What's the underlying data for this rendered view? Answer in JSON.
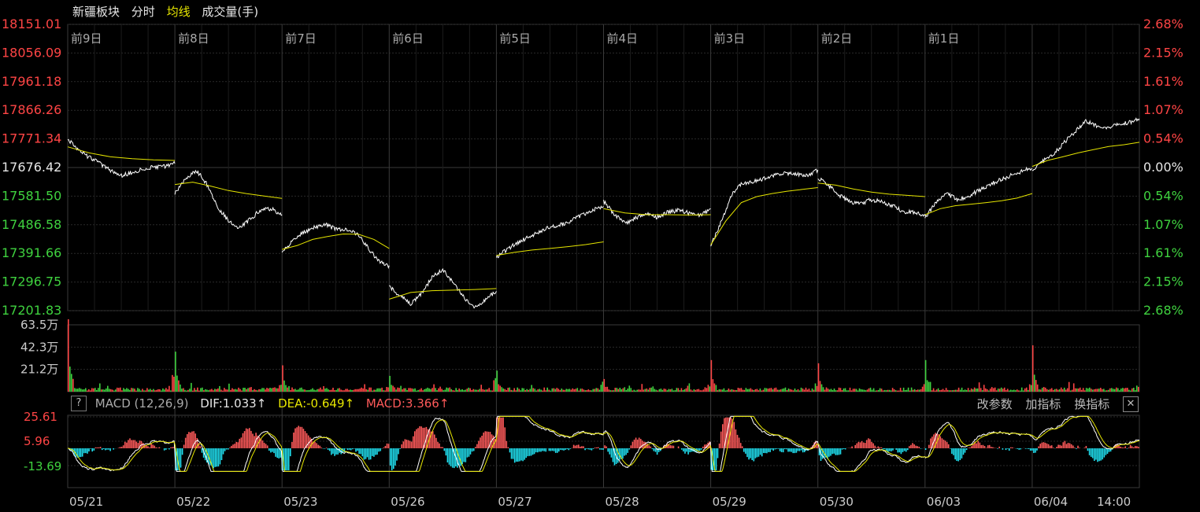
{
  "header": {
    "index_name": "新疆板块",
    "tab_intraday": "分时",
    "tab_avg": "均线",
    "tab_volume": "成交量(手)"
  },
  "colors": {
    "up": "#ff4545",
    "down": "#3fd23f",
    "price_line": "#ffffff",
    "avg_line": "#e6e600",
    "dea": "#e6e600",
    "macd_up": "#ff5a5a",
    "macd_down": "#20e0f0",
    "grid": "#2a2a2a"
  },
  "chart_data": {
    "type": "line",
    "day_labels": [
      "前9日",
      "前8日",
      "前7日",
      "前6日",
      "前5日",
      "前4日",
      "前3日",
      "前2日",
      "前1日",
      ""
    ],
    "x_dates": [
      "05/21",
      "05/22",
      "05/23",
      "05/26",
      "05/27",
      "05/28",
      "05/29",
      "05/30",
      "06/03",
      "06/04"
    ],
    "x_extra_label": "14:00",
    "y_left_ticks": [
      "18151.01",
      "18056.09",
      "17961.18",
      "17866.26",
      "17771.34",
      "17676.42",
      "17581.50",
      "17486.58",
      "17391.66",
      "17296.75",
      "17201.83"
    ],
    "y_right_ticks": [
      "2.68%",
      "2.15%",
      "1.61%",
      "1.07%",
      "0.54%",
      "0.00%",
      "0.54%",
      "1.07%",
      "1.61%",
      "2.15%",
      "2.68%"
    ],
    "ylim": [
      17201.83,
      18151.01
    ],
    "prev_close": 17676.42,
    "days": [
      {
        "price": [
          17770,
          17735,
          17710,
          17690,
          17665,
          17650,
          17660,
          17672,
          17678,
          17680,
          17690
        ],
        "avg": [
          17745,
          17725,
          17712,
          17706,
          17702,
          17700
        ]
      },
      {
        "price": [
          17592,
          17640,
          17668,
          17620,
          17545,
          17500,
          17475,
          17505,
          17535,
          17540,
          17520
        ],
        "avg": [
          17620,
          17628,
          17615,
          17600,
          17590,
          17582,
          17574
        ]
      },
      {
        "price": [
          17398,
          17432,
          17462,
          17478,
          17488,
          17472,
          17470,
          17458,
          17412,
          17365,
          17348
        ],
        "avg": [
          17405,
          17418,
          17438,
          17448,
          17456,
          17455,
          17438,
          17408
        ]
      },
      {
        "price": [
          17282,
          17252,
          17222,
          17258,
          17312,
          17338,
          17292,
          17244,
          17215,
          17238,
          17266
        ],
        "avg": [
          17240,
          17262,
          17268,
          17270,
          17272,
          17275
        ]
      },
      {
        "price": [
          17380,
          17405,
          17428,
          17445,
          17465,
          17478,
          17486,
          17500,
          17520,
          17535,
          17548
        ],
        "avg": [
          17385,
          17395,
          17403,
          17408,
          17414,
          17421,
          17430
        ]
      },
      {
        "price": [
          17565,
          17522,
          17492,
          17508,
          17522,
          17512,
          17528,
          17535,
          17525,
          17518,
          17535
        ],
        "avg": [
          17540,
          17526,
          17520,
          17520,
          17519,
          17520
        ]
      },
      {
        "price": [
          17415,
          17500,
          17590,
          17625,
          17630,
          17640,
          17650,
          17658,
          17656,
          17650,
          17667
        ],
        "avg": [
          17420,
          17500,
          17560,
          17580,
          17590,
          17598,
          17604,
          17610
        ]
      },
      {
        "price": [
          17642,
          17616,
          17585,
          17563,
          17557,
          17570,
          17562,
          17549,
          17530,
          17528,
          17520
        ],
        "avg": [
          17625,
          17618,
          17605,
          17595,
          17588,
          17584,
          17580
        ]
      },
      {
        "price": [
          17510,
          17560,
          17590,
          17570,
          17580,
          17600,
          17620,
          17635,
          17650,
          17664,
          17675
        ],
        "avg": [
          17520,
          17540,
          17550,
          17555,
          17560,
          17566,
          17575,
          17590
        ]
      },
      {
        "price": [
          17670,
          17700,
          17720,
          17760,
          17795,
          17830,
          17815,
          17810,
          17818,
          17825,
          17840
        ],
        "avg": [
          17680,
          17700,
          17712,
          17725,
          17736,
          17746,
          17752,
          17760
        ]
      }
    ],
    "volume": {
      "y_ticks": [
        "63.5万",
        "42.3万",
        "21.2万"
      ],
      "ylim": [
        0,
        63.5
      ],
      "unit": "万",
      "day_open_spikes": [
        63,
        38,
        25,
        15,
        20,
        12,
        30,
        27,
        30,
        44
      ],
      "day_close_spikes": [
        18,
        10,
        8,
        16,
        12,
        8,
        9,
        6,
        10,
        8
      ]
    },
    "macd": {
      "title": "MACD (12,26,9)",
      "dif_label": "DIF:1.033↑",
      "dea_label": "DEA:-0.649↑",
      "macd_label": "MACD:3.366↑",
      "y_ticks": [
        "25.61",
        "5.96",
        "-13.69"
      ],
      "ylim": [
        -22,
        30
      ],
      "btn_params": "改参数",
      "btn_add": "加指标",
      "btn_switch": "换指标",
      "btn_help": "?",
      "btn_close": "✕"
    }
  }
}
